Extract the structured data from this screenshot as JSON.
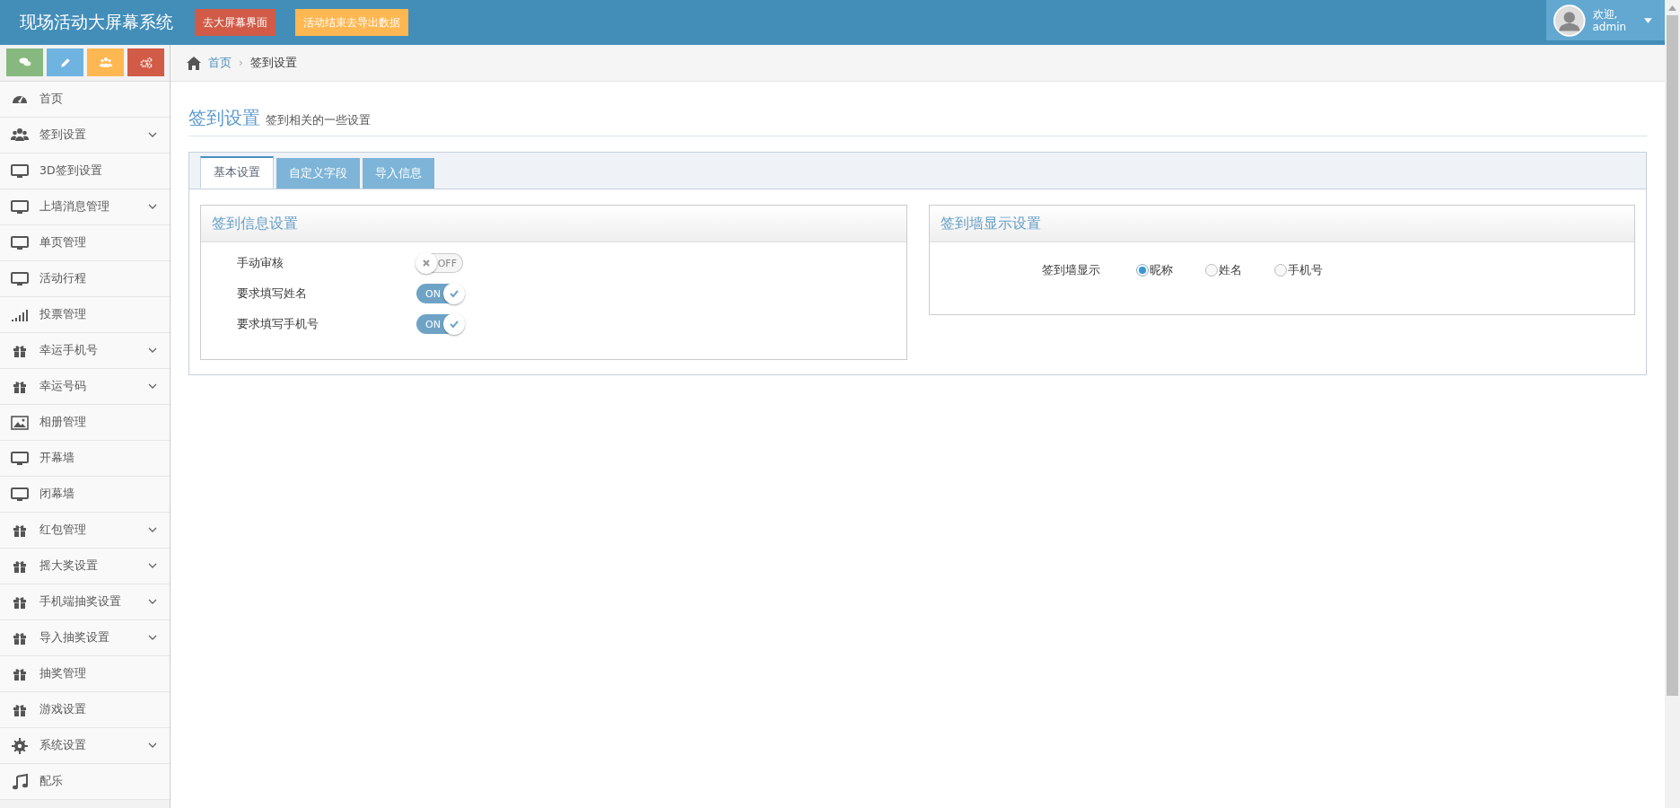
{
  "header": {
    "title": "现场活动大屏幕系统",
    "buttons": [
      {
        "label": "去大屏幕界面",
        "kind": "danger"
      },
      {
        "label": "活动结束去导出数据",
        "kind": "warning"
      }
    ],
    "user": {
      "greeting": "欢迎,",
      "name": "admin"
    }
  },
  "shortcuts": [
    {
      "kind": "comments",
      "color": "#87b87f"
    },
    {
      "kind": "pencil",
      "color": "#6fb3e0"
    },
    {
      "kind": "users",
      "color": "#ffb752"
    },
    {
      "kind": "cogs",
      "color": "#d15b47"
    }
  ],
  "sidebar": {
    "items": [
      {
        "label": "首页",
        "kind": "dashboard",
        "expandable": false
      },
      {
        "label": "签到设置",
        "kind": "users",
        "expandable": true
      },
      {
        "label": "3D签到设置",
        "kind": "monitor",
        "expandable": false
      },
      {
        "label": "上墙消息管理",
        "kind": "monitor",
        "expandable": true
      },
      {
        "label": "单页管理",
        "kind": "monitor",
        "expandable": false
      },
      {
        "label": "活动行程",
        "kind": "monitor",
        "expandable": false
      },
      {
        "label": "投票管理",
        "kind": "signal",
        "expandable": false
      },
      {
        "label": "幸运手机号",
        "kind": "gift",
        "expandable": true
      },
      {
        "label": "幸运号码",
        "kind": "gift",
        "expandable": true
      },
      {
        "label": "相册管理",
        "kind": "image",
        "expandable": false
      },
      {
        "label": "开幕墙",
        "kind": "monitor",
        "expandable": false
      },
      {
        "label": "闭幕墙",
        "kind": "monitor",
        "expandable": false
      },
      {
        "label": "红包管理",
        "kind": "gift",
        "expandable": true
      },
      {
        "label": "摇大奖设置",
        "kind": "gift",
        "expandable": true
      },
      {
        "label": "手机端抽奖设置",
        "kind": "gift",
        "expandable": true
      },
      {
        "label": "导入抽奖设置",
        "kind": "gift",
        "expandable": true
      },
      {
        "label": "抽奖管理",
        "kind": "gift",
        "expandable": false
      },
      {
        "label": "游戏设置",
        "kind": "gift",
        "expandable": false
      },
      {
        "label": "系统设置",
        "kind": "gear",
        "expandable": true
      },
      {
        "label": "配乐",
        "kind": "music",
        "expandable": false
      }
    ]
  },
  "breadcrumb": {
    "separator": "›",
    "items": [
      {
        "label": "首页",
        "link": true
      },
      {
        "label": "签到设置",
        "link": false
      }
    ]
  },
  "page_header": {
    "title": "签到设置",
    "subtitle": "签到相关的一些设置"
  },
  "tabs": [
    {
      "label": "基本设置",
      "selected": true
    },
    {
      "label": "自定义字段",
      "selected": false
    },
    {
      "label": "导入信息",
      "selected": false
    }
  ],
  "panels": [
    {
      "title": "签到信息设置",
      "kind": "toggles",
      "rows": [
        {
          "label": "手动审核",
          "on": false,
          "switch_text": "OFF"
        },
        {
          "label": "要求填写姓名",
          "on": true,
          "switch_text": "ON"
        },
        {
          "label": "要求填写手机号",
          "on": true,
          "switch_text": "ON"
        }
      ]
    },
    {
      "title": "签到墙显示设置",
      "kind": "radios",
      "label": "签到墙显示",
      "options": [
        {
          "label": "昵称",
          "selected": true
        },
        {
          "label": "姓名",
          "selected": false
        },
        {
          "label": "手机号",
          "selected": false
        }
      ]
    }
  ]
}
